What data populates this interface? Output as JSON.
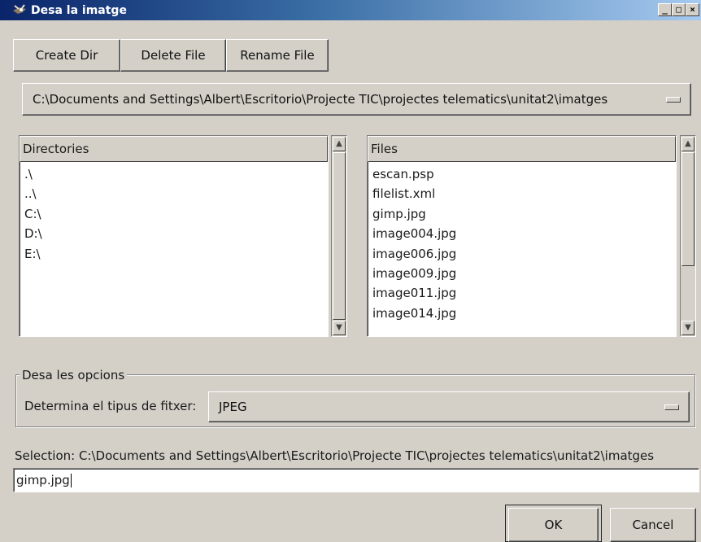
{
  "window": {
    "title": "Desa la imatge",
    "controls": [
      "_",
      "□",
      "×"
    ]
  },
  "toolbar": {
    "create_dir": "Create Dir",
    "delete_file": "Delete File",
    "rename_file": "Rename File"
  },
  "path_menu": {
    "value": "C:\\Documents and Settings\\Albert\\Escritorio\\Projecte TIC\\projectes telematics\\unitat2\\imatges"
  },
  "directories": {
    "header": "Directories",
    "items": [
      ".\\",
      "..\\",
      "C:\\",
      "D:\\",
      "E:\\"
    ]
  },
  "files": {
    "header": "Files",
    "items": [
      "escan.psp",
      "filelist.xml",
      "gimp.jpg",
      "image004.jpg",
      "image006.jpg",
      "image009.jpg",
      "image011.jpg",
      "image014.jpg"
    ]
  },
  "options": {
    "group_label": "Desa les opcions",
    "filetype_label": "Determina el tipus de fitxer:",
    "filetype_value": "JPEG"
  },
  "selection": {
    "label": "Selection: C:\\Documents and Settings\\Albert\\Escritorio\\Projecte TIC\\projectes telematics\\unitat2\\imatges",
    "value": "gimp.jpg"
  },
  "actions": {
    "ok": "OK",
    "cancel": "Cancel"
  },
  "icons": {
    "title": "gimp-wilber-icon",
    "scroll_up": "scroll-up-arrow-icon",
    "scroll_down": "scroll-down-arrow-icon"
  }
}
